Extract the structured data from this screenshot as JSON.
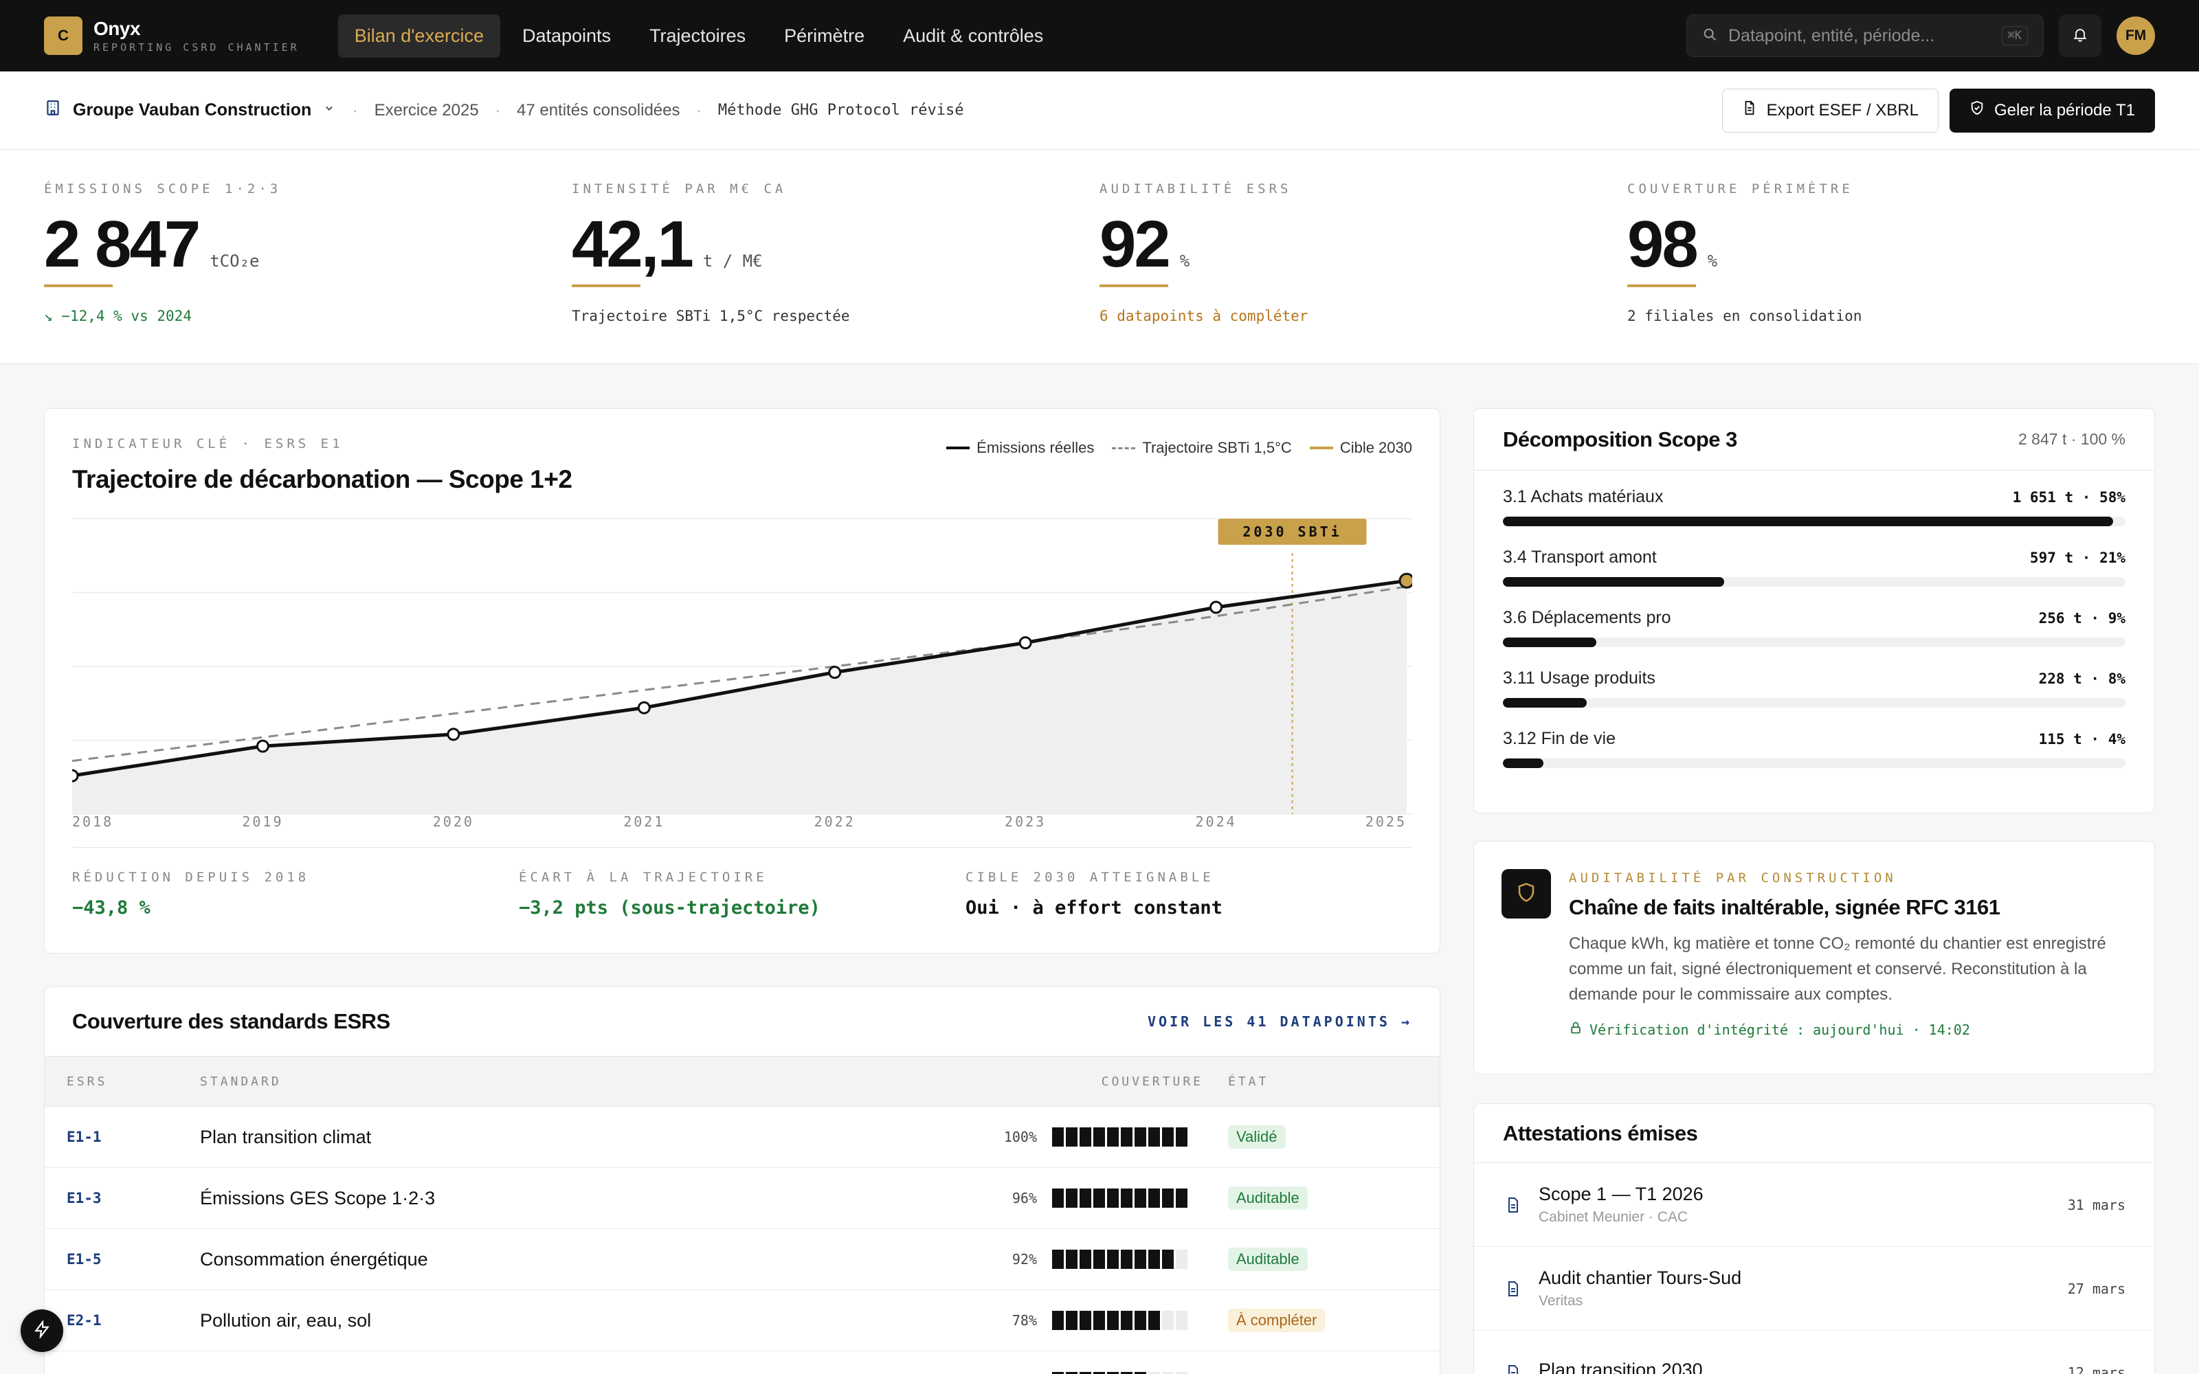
{
  "app": {
    "logo_letter": "C",
    "name": "Onyx",
    "subtitle": "REPORTING CSRD CHANTIER"
  },
  "nav": [
    {
      "label": "Bilan d'exercice",
      "active": true
    },
    {
      "label": "Datapoints",
      "active": false
    },
    {
      "label": "Trajectoires",
      "active": false
    },
    {
      "label": "Périmètre",
      "active": false
    },
    {
      "label": "Audit & contrôles",
      "active": false
    }
  ],
  "search": {
    "placeholder": "Datapoint, entité, période...",
    "shortcut": "⌘K"
  },
  "user": {
    "initials": "FM"
  },
  "context": {
    "organization": "Groupe Vauban Construction",
    "exercise": "Exercice 2025",
    "entities": "47 entités consolidées",
    "method": "Méthode GHG Protocol révisé",
    "export_label": "Export ESEF / XBRL",
    "freeze_label": "Geler la période T1"
  },
  "kpis": [
    {
      "label": "ÉMISSIONS SCOPE 1·2·3",
      "value": "2 847",
      "unit": "tCO₂e",
      "note": "↘ −12,4 % vs 2024",
      "tone": "green"
    },
    {
      "label": "INTENSITÉ PAR M€ CA",
      "value": "42,1",
      "unit": "t / M€",
      "note": "Trajectoire SBTi 1,5°C respectée",
      "tone": "neutral"
    },
    {
      "label": "AUDITABILITÉ ESRS",
      "value": "92",
      "unit": "%",
      "note": "6 datapoints à compléter",
      "tone": "amber"
    },
    {
      "label": "COUVERTURE PÉRIMÈTRE",
      "value": "98",
      "unit": "%",
      "note": "2 filiales en consolidation",
      "tone": "neutral"
    }
  ],
  "chart_card": {
    "eyebrow": "INDICATEUR CLÉ · ESRS E1",
    "title": "Trajectoire de décarbonation — Scope 1+2",
    "legend": [
      "Émissions réelles",
      "Trajectoire SBTi 1,5°C",
      "Cible 2030"
    ],
    "marker_label": "2030 SBTi",
    "footer": [
      {
        "label": "RÉDUCTION DEPUIS 2018",
        "value": "−43,8 %",
        "tone": "green"
      },
      {
        "label": "ÉCART À LA TRAJECTOIRE",
        "value": "−3,2 pts (sous-trajectoire)",
        "tone": "green"
      },
      {
        "label": "CIBLE 2030 ATTEIGNABLE",
        "value": "Oui · à effort constant",
        "tone": "neutral"
      }
    ]
  },
  "chart_data": {
    "type": "line",
    "x": [
      2018,
      2019,
      2020,
      2021,
      2022,
      2023,
      2024,
      2025
    ],
    "x_tick_labels": [
      "2018",
      "2019",
      "2020",
      "2021",
      "2022",
      "2023",
      "2024",
      "2025"
    ],
    "series": [
      {
        "name": "Émissions réelles",
        "style": "solid",
        "color": "#111111",
        "values": [
          0.13,
          0.23,
          0.27,
          0.36,
          0.48,
          0.58,
          0.7,
          0.79
        ]
      },
      {
        "name": "Trajectoire SBTi 1,5°C",
        "style": "dashed",
        "color": "#8a8a8a",
        "values": [
          0.18,
          0.26,
          0.34,
          0.42,
          0.5,
          0.58,
          0.67,
          0.77
        ]
      }
    ],
    "marker": {
      "x": 2024.4,
      "label": "2030 SBTi",
      "color": "#c9a14a"
    },
    "ylim": [
      0,
      1
    ],
    "grid": true,
    "legend_position": "top-right"
  },
  "scope3": {
    "title": "Décomposition Scope 3",
    "total": "2 847 t · 100 %",
    "items": [
      {
        "name": "3.1 Achats matériaux",
        "value": "1 651 t · 58%",
        "share": 0.98
      },
      {
        "name": "3.4 Transport amont",
        "value": "597 t · 21%",
        "share": 0.355
      },
      {
        "name": "3.6 Déplacements pro",
        "value": "256 t · 9%",
        "share": 0.15
      },
      {
        "name": "3.11 Usage produits",
        "value": "228 t · 8%",
        "share": 0.135
      },
      {
        "name": "3.12 Fin de vie",
        "value": "115 t · 4%",
        "share": 0.065
      }
    ]
  },
  "audit": {
    "eyebrow": "AUDITABILITÉ PAR CONSTRUCTION",
    "title": "Chaîne de faits inaltérable, signée RFC 3161",
    "text": "Chaque kWh, kg matière et tonne CO₂ remonté du chantier est enregistré comme un fait, signé électroniquement et conservé. Reconstitution à la demande pour le commissaire aux comptes.",
    "check": "Vérification d'intégrité : aujourd'hui · 14:02"
  },
  "attestations": {
    "title": "Attestations émises",
    "items": [
      {
        "name": "Scope 1 — T1 2026",
        "sub": "Cabinet Meunier · CAC",
        "date": "31 mars"
      },
      {
        "name": "Audit chantier Tours-Sud",
        "sub": "Veritas",
        "date": "27 mars"
      },
      {
        "name": "Plan transition 2030",
        "sub": "",
        "date": "12 mars"
      }
    ]
  },
  "esrs": {
    "title": "Couverture des standards ESRS",
    "link": "VOIR LES 41 DATAPOINTS →",
    "headers": {
      "code": "ESRS",
      "standard": "STANDARD",
      "coverage": "COUVERTURE",
      "state": "ÉTAT"
    },
    "rows": [
      {
        "code": "E1-1",
        "standard": "Plan transition climat",
        "coverage": "100%",
        "cov": 1.0,
        "state": "Validé",
        "tone": "ok"
      },
      {
        "code": "E1-3",
        "standard": "Émissions GES Scope 1·2·3",
        "coverage": "96%",
        "cov": 0.96,
        "state": "Auditable",
        "tone": "ok"
      },
      {
        "code": "E1-5",
        "standard": "Consommation énergétique",
        "coverage": "92%",
        "cov": 0.92,
        "state": "Auditable",
        "tone": "ok"
      },
      {
        "code": "E2-1",
        "standard": "Pollution air, eau, sol",
        "coverage": "78%",
        "cov": 0.78,
        "state": "À compléter",
        "tone": "warn"
      },
      {
        "code": "",
        "standard": "",
        "coverage": "",
        "cov": 0.7,
        "state": "",
        "tone": "warn"
      }
    ]
  },
  "colors": {
    "accent": "#c9a14a",
    "ink": "#111111",
    "green": "#1f7a3a",
    "amber": "#b7741a",
    "navy": "#1d3c7a"
  }
}
